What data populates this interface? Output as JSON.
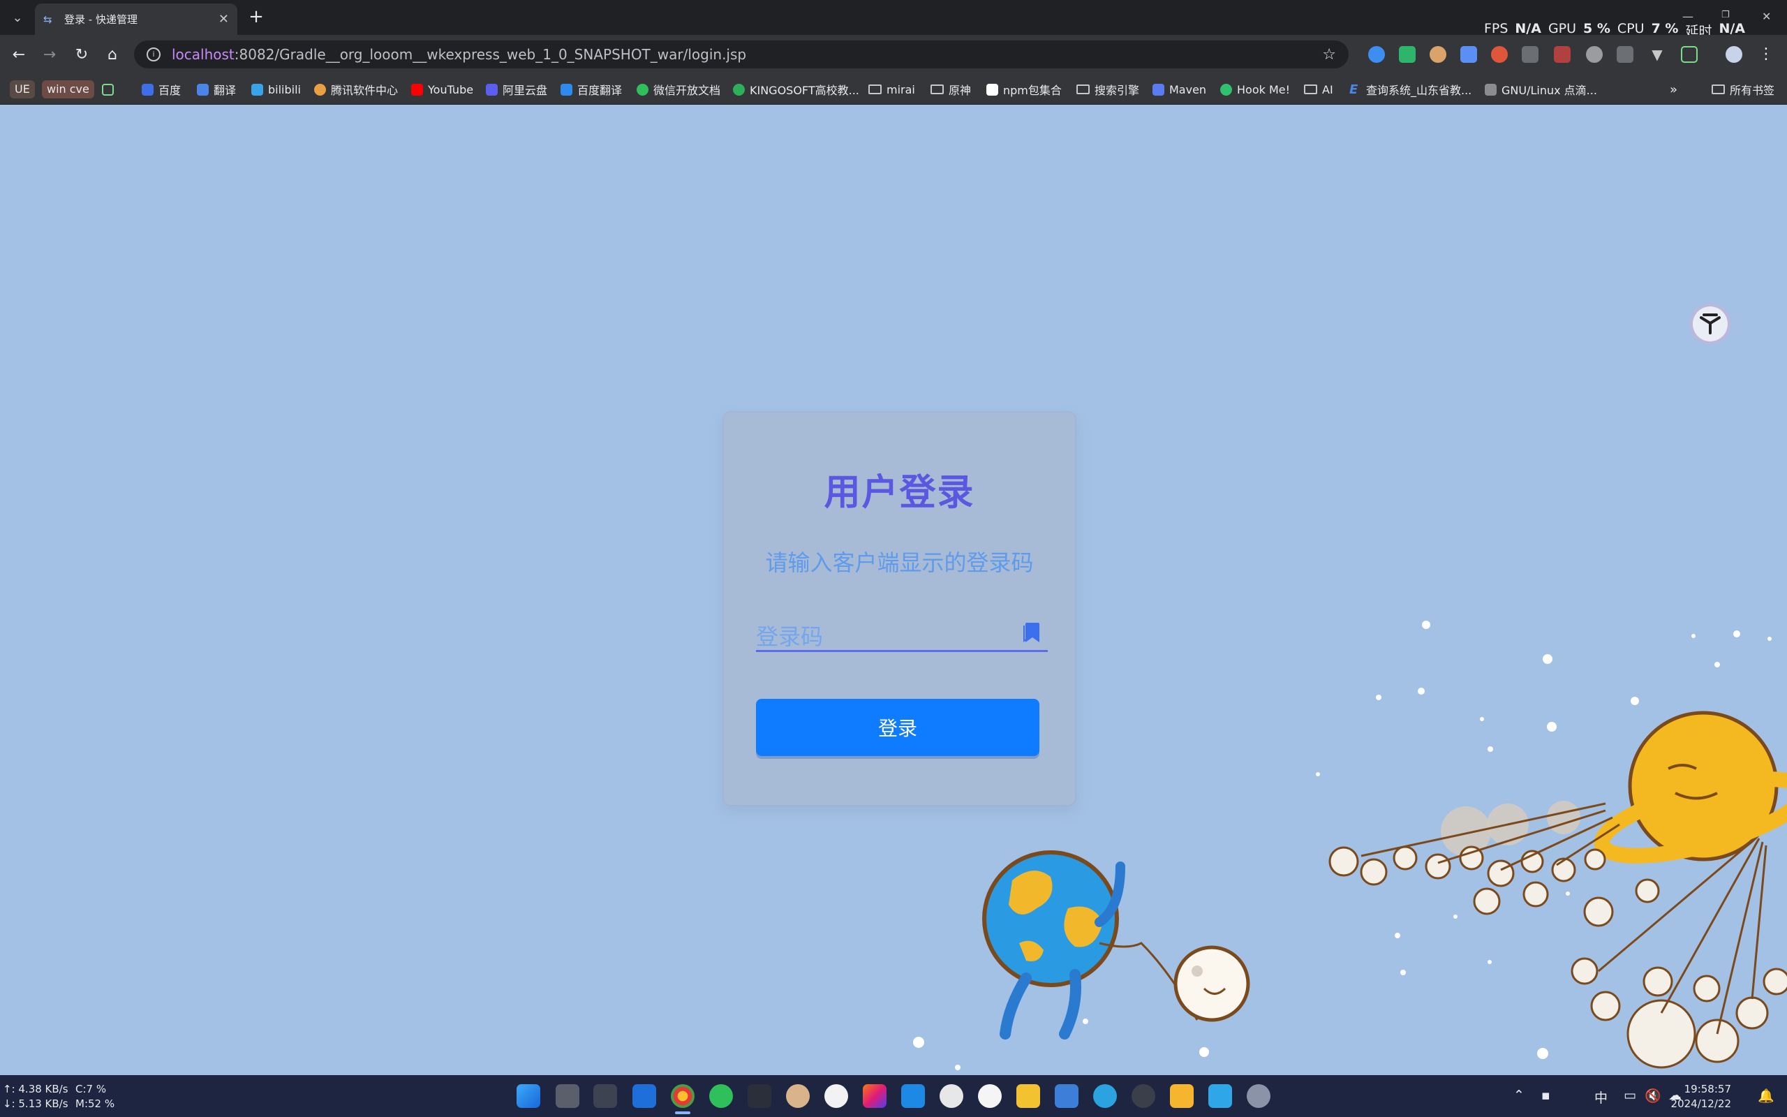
{
  "tab": {
    "title": "登录 - 快递管理",
    "close": "✕",
    "new_tab": "+"
  },
  "perf": {
    "fps_label": "FPS",
    "fps": "N/A",
    "gpu_label": "GPU",
    "gpu": "5 %",
    "cpu_label": "CPU",
    "cpu": "7 %",
    "latency_label": "延时",
    "latency": "N/A"
  },
  "address": {
    "host": "localhost",
    "path": ":8082/Gradle__org_looom__wkexpress_web_1_0_SNAPSHOT_war/login.jsp"
  },
  "bookmarks": {
    "pills": [
      "UE",
      "win cve"
    ],
    "items": [
      "百度",
      "翻译",
      "bilibili",
      "腾讯软件中心",
      "YouTube",
      "阿里云盘",
      "百度翻译",
      "微信开放文档",
      "KINGOSOFT高校教...",
      "mirai",
      "原神",
      "npm包集合",
      "搜索引擎",
      "Maven",
      "Hook Me!",
      "AI",
      "查询系统_山东省教...",
      "GNU/Linux 点滴..."
    ],
    "more": "»",
    "all_bookmarks": "所有书签"
  },
  "login": {
    "title": "用户登录",
    "subtitle": "请输入客户端显示的登录码",
    "placeholder": "登录码",
    "button": "登录"
  },
  "taskbar": {
    "upload": "↑: 4.38 KB/s",
    "download": "↓: 5.13 KB/s",
    "cpu": "C:7 %",
    "mem": "M:52 %",
    "ime": "中",
    "time": "19:58:57",
    "date": "2024/12/22"
  },
  "icons": {
    "back": "arrow-left-icon",
    "forward": "arrow-right-icon",
    "reload": "reload-icon",
    "home": "home-icon",
    "star": "star-icon",
    "bookmark": "bookmark-icon"
  }
}
